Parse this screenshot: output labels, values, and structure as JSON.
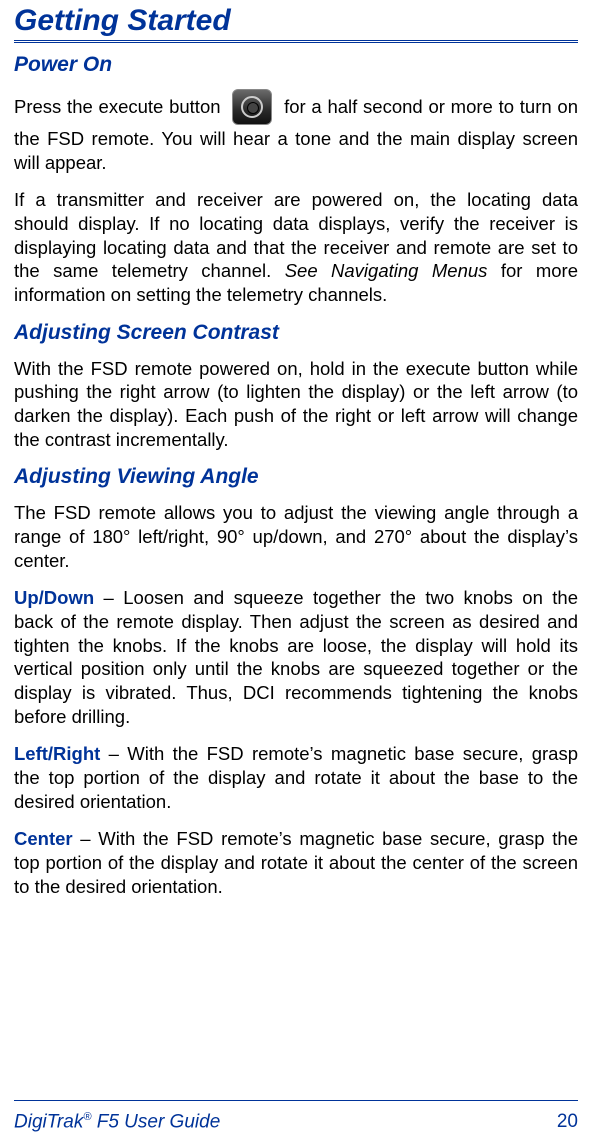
{
  "title": "Getting Started",
  "sections": {
    "power_on": {
      "heading": "Power On",
      "p1_pre": "Press the execute button ",
      "p1_post": " for a half second or more to turn on the FSD remote.  You will hear a tone and the main display screen will appear.",
      "p2_a": "If a transmitter and receiver are powered on, the locating data should display.  If no locating data displays, verify the receiver is displaying locating data and that the receiver and remote are set to the same telemetry channel.  ",
      "p2_ital": "See Navigating Menus",
      "p2_b": " for more information on setting the telemetry channels."
    },
    "contrast": {
      "heading": "Adjusting Screen Contrast",
      "p1": "With the FSD remote powered on, hold in the execute button while pushing the right arrow (to lighten the display) or the left arrow (to darken the display).  Each push of the right or left arrow will change the contrast incrementally."
    },
    "viewing": {
      "heading": "Adjusting Viewing Angle",
      "p1": "The FSD remote allows you to adjust the viewing angle through a range of 180° left/right, 90° up/down, and 270° about the display’s center.",
      "updown_label": "Up/Down",
      "updown_text": " – Loosen and squeeze together the two knobs on the back of the remote display. Then adjust the screen as desired and tighten the knobs. If the knobs are loose, the display will hold its vertical position only until the knobs are squeezed together or the display is vibrated. Thus, DCI recommends tightening the knobs before drilling.",
      "leftright_label": "Left/Right",
      "leftright_text": " – With the FSD remote’s magnetic base secure, grasp the top portion of the display and rotate it about the base to the desired orientation.",
      "center_label": "Center",
      "center_text": " – With the FSD remote’s magnetic base secure, grasp the top portion of the display and rotate it about the center of the screen to the desired orientation."
    }
  },
  "footer": {
    "guide_pre": "DigiTrak",
    "guide_sup": "®",
    "guide_post": " F5 User Guide",
    "page": "20"
  }
}
